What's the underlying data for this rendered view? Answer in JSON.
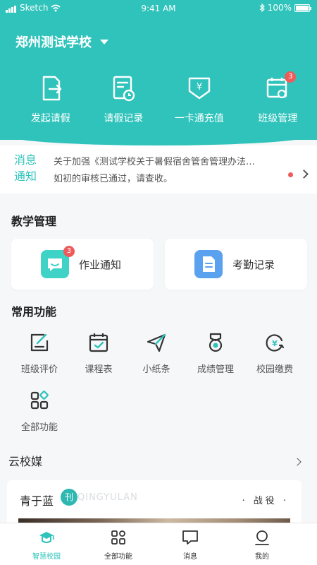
{
  "status_bar": {
    "carrier": "Sketch",
    "time": "9:41 AM",
    "battery": "100%"
  },
  "header": {
    "school_name": "郑州测试学校"
  },
  "quick_actions": [
    {
      "label": "发起请假",
      "icon": "leave-request-icon"
    },
    {
      "label": "请假记录",
      "icon": "leave-record-icon"
    },
    {
      "label": "一卡通充值",
      "icon": "card-recharge-icon"
    },
    {
      "label": "班级管理",
      "icon": "class-manage-icon",
      "badge": "3"
    }
  ],
  "notice": {
    "tag_line1": "消息",
    "tag_line2": "通知",
    "line1": "关于加强《测试学校关于暑假宿舍管舍管理办法…",
    "line2": "如初的审核已通过，请查收。"
  },
  "teaching": {
    "title": "教学管理",
    "cards": [
      {
        "label": "作业通知",
        "icon": "homework-icon",
        "badge": "3"
      },
      {
        "label": "考勤记录",
        "icon": "attendance-icon"
      }
    ]
  },
  "common": {
    "title": "常用功能",
    "items": [
      {
        "label": "班级评价",
        "icon": "class-evaluation-icon"
      },
      {
        "label": "课程表",
        "icon": "schedule-icon"
      },
      {
        "label": "小纸条",
        "icon": "paper-plane-icon"
      },
      {
        "label": "成绩管理",
        "icon": "grades-medal-icon"
      },
      {
        "label": "校园缴费",
        "icon": "campus-payment-icon"
      },
      {
        "label": "全部功能",
        "icon": "all-functions-icon"
      }
    ]
  },
  "media": {
    "title": "云校媒",
    "name": "青于蓝",
    "logo_text": "刊",
    "watermark": "QINGYULAN",
    "tag": "· 战役 ·"
  },
  "tabbar": [
    {
      "label": "智慧校园",
      "icon": "campus-icon",
      "active": true
    },
    {
      "label": "全部功能",
      "icon": "grid-icon"
    },
    {
      "label": "消息",
      "icon": "message-icon"
    },
    {
      "label": "我的",
      "icon": "profile-icon"
    }
  ],
  "colors": {
    "primary": "#2fc3bb",
    "badge": "#ee5b5b",
    "homework": "#3fd2c7",
    "attendance": "#5aa2f0"
  }
}
